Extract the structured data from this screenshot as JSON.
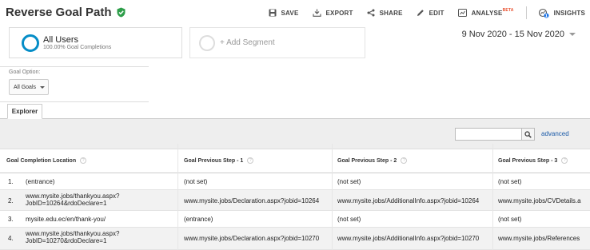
{
  "header": {
    "title": "Reverse Goal Path",
    "toolbar": {
      "save": "SAVE",
      "export": "EXPORT",
      "share": "SHARE",
      "edit": "EDIT",
      "analyse": "ANALYSE",
      "beta": "BETA",
      "insights": "INSIGHTS",
      "insights_badge": "1"
    }
  },
  "segments": {
    "active_title": "All Users",
    "active_sub": "100.00% Goal Completions",
    "add_label": "+ Add Segment"
  },
  "date_range": "9 Nov 2020 - 15 Nov 2020",
  "goal_option": {
    "label": "Goal Option:",
    "selected": "All Goals"
  },
  "tabs": {
    "explorer": "Explorer"
  },
  "table_toolbar": {
    "search_placeholder": "",
    "advanced": "advanced"
  },
  "table": {
    "headers": [
      "Goal Completion Location",
      "Goal Previous Step - 1",
      "Goal Previous Step - 2",
      "Goal Previous Step - 3"
    ],
    "help_glyph": "?",
    "rows": [
      {
        "num": "1.",
        "loc1": "(entrance)",
        "loc2": "",
        "step1": "(not set)",
        "step2": "(not set)",
        "step3": "(not set)"
      },
      {
        "num": "2.",
        "loc1": "www.mysite.jobs/thankyou.aspx?",
        "loc2": "JobID=10264&rdoDeclare=1",
        "step1": "www.mysite.jobs/Declaration.aspx?jobid=10264",
        "step2": "www.mysite.jobs/AdditionalInfo.aspx?jobid=10264",
        "step3": "www.mysite.jobs/CVDetails.a"
      },
      {
        "num": "3.",
        "loc1": "mysite.edu.ec/en/thank-you/",
        "loc2": "",
        "step1": "(entrance)",
        "step2": "(not set)",
        "step3": "(not set)"
      },
      {
        "num": "4.",
        "loc1": "www.mysite.jobs/thankyou.aspx?",
        "loc2": "JobID=10270&rdoDeclare=1",
        "step1": "www.mysite.jobs/Declaration.aspx?jobid=10270",
        "step2": "www.mysite.jobs/AdditionalInfo.aspx?jobid=10270",
        "step3": "www.mysite.jobs/References"
      }
    ]
  },
  "colors": {
    "accent_blue": "#058dc7",
    "link_blue": "#1a5aa8",
    "verified_green": "#2e9e4a",
    "beta_red": "#e94f2e"
  }
}
